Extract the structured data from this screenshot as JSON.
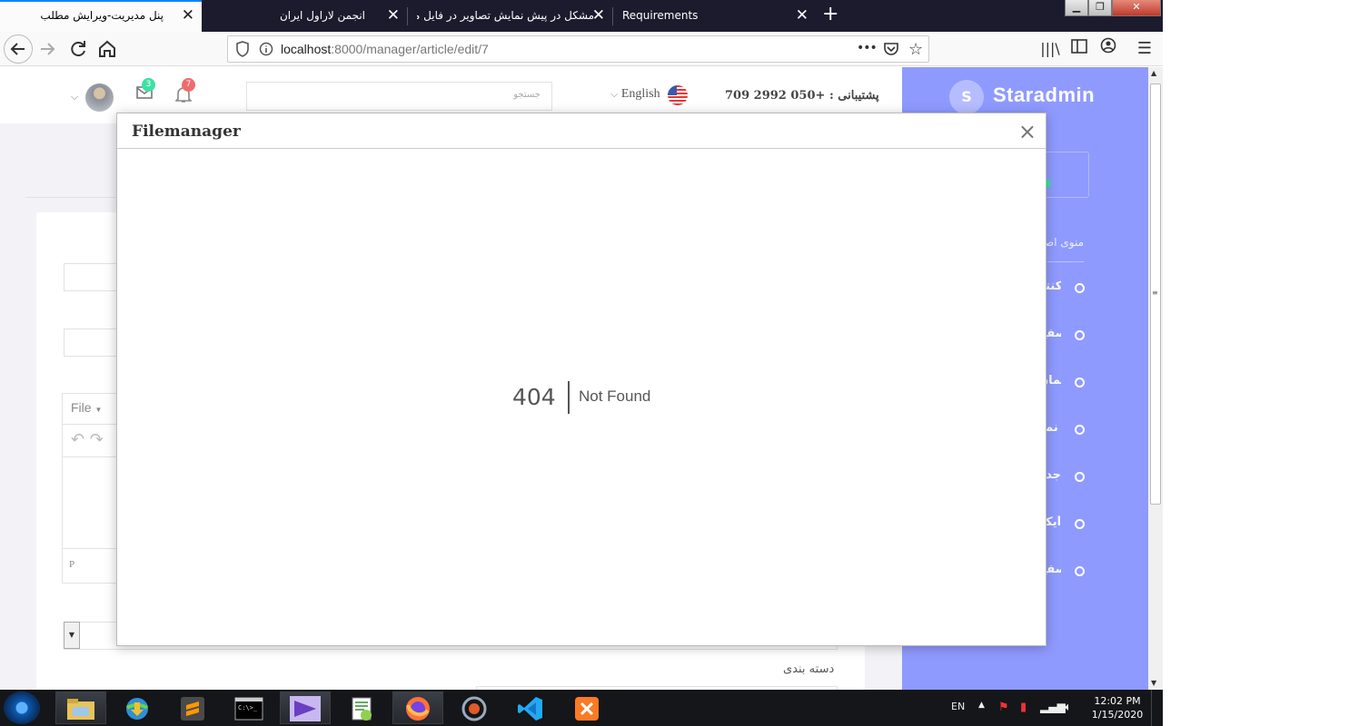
{
  "browser": {
    "tabs": [
      {
        "title": "پنل مدیریت-ویرایش مطلب",
        "active": true
      },
      {
        "title": "انجمن لاراول ایران",
        "active": false
      },
      {
        "title": "مشکل در پیش نمایش تصاویر در فایل منیج",
        "active": false
      },
      {
        "title": "Requirements",
        "active": false
      }
    ],
    "url_host": "localhost",
    "url_rest": ":8000/manager/article/edit/7",
    "more_label": "•••"
  },
  "page": {
    "brand": "Staradmin",
    "brand_initial": "S",
    "support": "پشتیبانی : +050 2992 709",
    "language": "English",
    "search_placeholder": "جستجو",
    "notification_count": "7",
    "mail_count": "3",
    "sidebar_category": "منوی اصلی",
    "sidebar_items": [
      "کنتر",
      "صفح",
      "المان",
      "نمو",
      "جدو",
      "آیکو",
      "صفح"
    ],
    "editor_menu": "File",
    "editor_status": "P",
    "category_label": "دسته بندی"
  },
  "modal": {
    "title": "Filemanager",
    "close": "×",
    "error_code": "404",
    "error_message": "Not Found"
  },
  "taskbar": {
    "language": "EN",
    "time": "12:02 PM",
    "date": "1/15/2020"
  },
  "colors": {
    "sidebar": "#8f9aff",
    "badge_red": "#f26b6b",
    "badge_green": "#3ee0a3",
    "tab_bar": "#1c1b2e"
  }
}
